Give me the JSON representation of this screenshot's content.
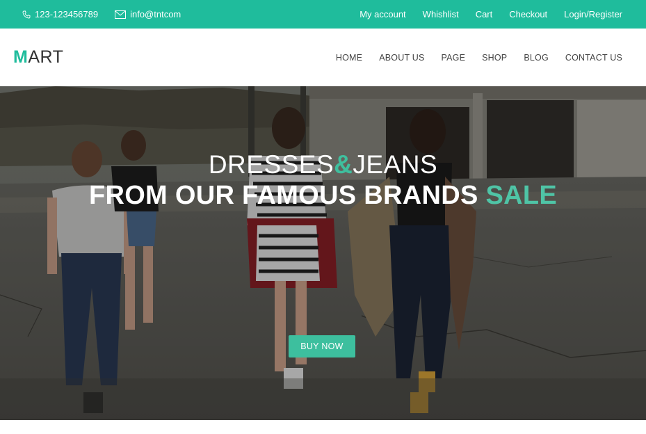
{
  "topbar": {
    "phone": "123-123456789",
    "phone_icon": "phone-icon",
    "email": "info@tntcom",
    "email_icon": "envelope-icon",
    "links": [
      "My account",
      "Whishlist",
      "Cart",
      "Checkout",
      "Login/Register"
    ],
    "background": "#1fbc9c"
  },
  "header": {
    "logo_first": "M",
    "logo_rest": "ART",
    "nav": [
      "HOME",
      "ABOUT US",
      "PAGE",
      "SHOP",
      "BLOG",
      "CONTACT US"
    ]
  },
  "hero": {
    "line1_a": "DRESSES",
    "line1_amp": "&",
    "line1_b": "JEANS",
    "line2_main": "FROM OUR FAMOUS BRANDS ",
    "line2_sale": "SALE",
    "button": "BUY NOW",
    "accent": "#3dbf9e"
  }
}
